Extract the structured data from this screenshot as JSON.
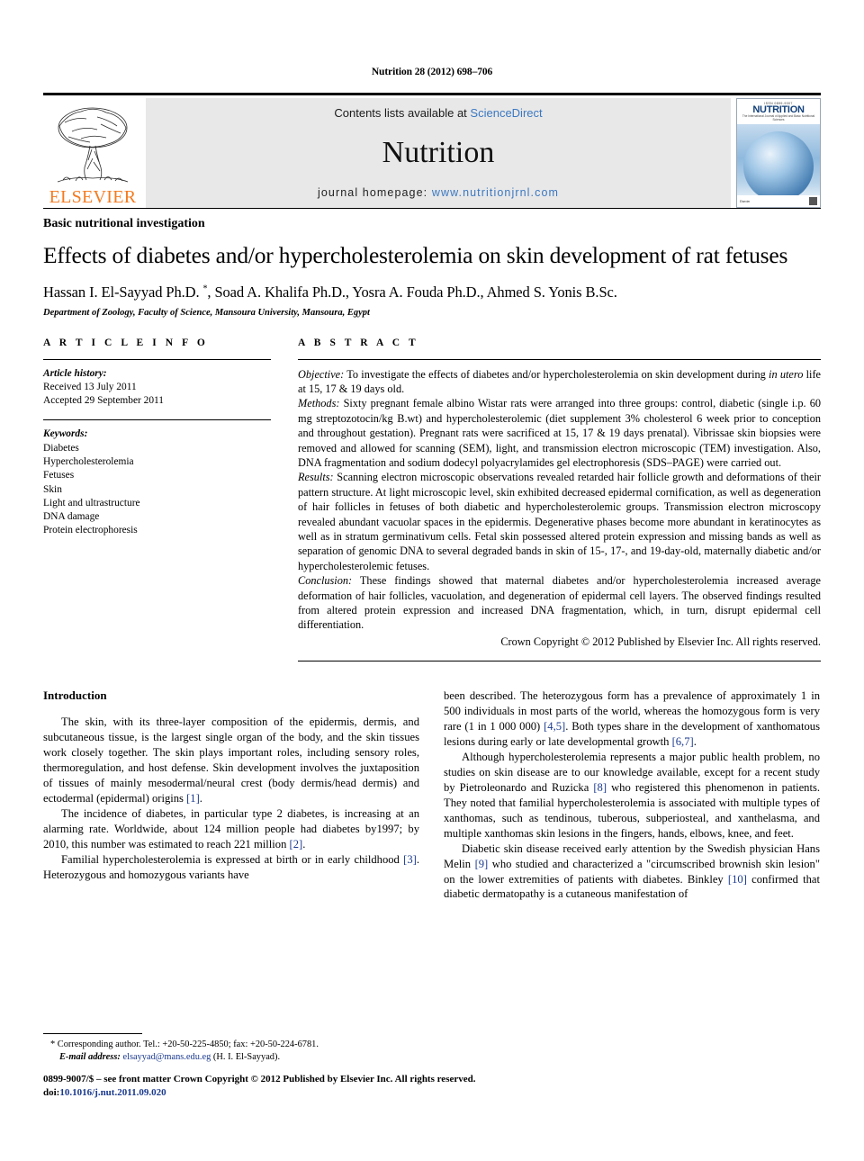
{
  "running_head": "Nutrition 28 (2012) 698–706",
  "masthead": {
    "publisher_name": "ELSEVIER",
    "contents_prefix": "Contents lists available at",
    "contents_link": "ScienceDirect",
    "journal_name": "Nutrition",
    "homepage_label": "journal homepage:",
    "homepage_url": "www.nutritionjrnl.com",
    "cover": {
      "kicker": "ISSN 0899-9007",
      "title": "NUTRITION",
      "subtitle": "The International Journal of Applied and Basic Nutritional Sciences",
      "footer_left": "Elsevier",
      "footer_right": "Elsevier"
    }
  },
  "article": {
    "type": "Basic nutritional investigation",
    "title": "Effects of diabetes and/or hypercholesterolemia on skin development of rat fetuses",
    "authors": "Hassan I. El-Sayyad Ph.D. *, Soad A. Khalifa Ph.D., Yosra A. Fouda Ph.D., Ahmed S. Yonis B.Sc.",
    "affiliation": "Department of Zoology, Faculty of Science, Mansoura University, Mansoura, Egypt"
  },
  "article_info": {
    "heading": "A R T I C L E   I N F O",
    "history_label": "Article history:",
    "history": [
      "Received 13 July 2011",
      "Accepted 29 September 2011"
    ],
    "keywords_label": "Keywords:",
    "keywords": [
      "Diabetes",
      "Hypercholesterolemia",
      "Fetuses",
      "Skin",
      "Light and ultrastructure",
      "DNA damage",
      "Protein electrophoresis"
    ]
  },
  "abstract": {
    "heading": "A B S T R A C T",
    "objective_label": "Objective:",
    "objective_text_1": " To investigate the effects of diabetes and/or hypercholesterolemia on skin development during ",
    "objective_italic": "in utero",
    "objective_text_2": " life at 15, 17 & 19 days old.",
    "methods_label": "Methods:",
    "methods_text": " Sixty pregnant female albino Wistar rats were arranged into three groups: control, diabetic (single i.p. 60 mg streptozotocin/kg B.wt) and hypercholesterolemic (diet supplement 3% cholesterol 6 week prior to conception and throughout gestation). Pregnant rats were sacrificed at 15, 17 & 19 days prenatal). Vibrissae skin biopsies were removed and allowed for scanning (SEM), light, and transmission electron microscopic (TEM) investigation. Also, DNA fragmentation and sodium dodecyl polyacrylamides gel electrophoresis (SDS–PAGE) were carried out.",
    "results_label": "Results:",
    "results_text": " Scanning electron microscopic observations revealed retarded hair follicle growth and deformations of their pattern structure. At light microscopic level, skin exhibited decreased epidermal cornification, as well as degeneration of hair follicles in fetuses of both diabetic and hypercholesterolemic groups. Transmission electron microscopy revealed abundant vacuolar spaces in the epidermis. Degenerative phases become more abundant in keratinocytes as well as in stratum germinativum cells. Fetal skin possessed altered protein expression and missing bands as well as separation of genomic DNA to several degraded bands in skin of 15-, 17-, and 19-day-old, maternally diabetic and/or hypercholesterolemic fetuses.",
    "conclusion_label": "Conclusion:",
    "conclusion_text": " These findings showed that maternal diabetes and/or hypercholesterolemia increased average deformation of hair follicles, vacuolation, and degeneration of epidermal cell layers. The observed findings resulted from altered protein expression and increased DNA fragmentation, which, in turn, disrupt epidermal cell differentiation.",
    "copyright": "Crown Copyright © 2012 Published by Elsevier Inc. All rights reserved."
  },
  "introduction": {
    "heading": "Introduction",
    "left_paragraphs": [
      "The skin, with its three-layer composition of the epidermis, dermis, and subcutaneous tissue, is the largest single organ of the body, and the skin tissues work closely together. The skin plays important roles, including sensory roles, thermoregulation, and host defense. Skin development involves the juxtaposition of tissues of mainly mesodermal/neural crest (body dermis/head dermis) and ectodermal (epidermal) origins [1].",
      "The incidence of diabetes, in particular type 2 diabetes, is increasing at an alarming rate. Worldwide, about 124 million people had diabetes by1997; by 2010, this number was estimated to reach 221 million [2].",
      "Familial hypercholesterolemia is expressed at birth or in early childhood [3]. Heterozygous and homozygous variants have"
    ],
    "right_paragraphs": [
      "been described. The heterozygous form has a prevalence of approximately 1 in 500 individuals in most parts of the world, whereas the homozygous form is very rare (1 in 1 000 000) [4,5]. Both types share in the development of xanthomatous lesions during early or late developmental growth [6,7].",
      "Although hypercholesterolemia represents a major public health problem, no studies on skin disease are to our knowledge available, except for a recent study by Pietroleonardo and Ruzicka [8] who registered this phenomenon in patients. They noted that familial hypercholesterolemia is associated with multiple types of xanthomas, such as tendinous, tuberous, subperiosteal, and xanthelasma, and multiple xanthomas skin lesions in the fingers, hands, elbows, knee, and feet.",
      "Diabetic skin disease received early attention by the Swedish physician Hans Melin [9] who studied and characterized a \"circumscribed brownish skin lesion\" on the lower extremities of patients with diabetes. Binkley [10] confirmed that diabetic dermatopathy is a cutaneous manifestation of"
    ]
  },
  "footnotes": {
    "corresponding_marker": "*",
    "corresponding_text": " Corresponding author. Tel.: +20-50-225-4850; fax: +20-50-224-6781.",
    "email_label": "E-mail address:",
    "email": "elsayyad@mans.edu.eg",
    "email_owner": " (H. I. El-Sayyad)."
  },
  "footer": {
    "issn_line": "0899-9007/$ – see front matter Crown Copyright © 2012 Published by Elsevier Inc. All rights reserved.",
    "doi_label": "doi:",
    "doi_value": "10.1016/j.nut.2011.09.020"
  },
  "colors": {
    "link_blue": "#3b78c2",
    "ref_blue": "#1b3a8f",
    "elsevier_orange": "#F47B20",
    "masthead_grey": "#e8e8e8"
  }
}
